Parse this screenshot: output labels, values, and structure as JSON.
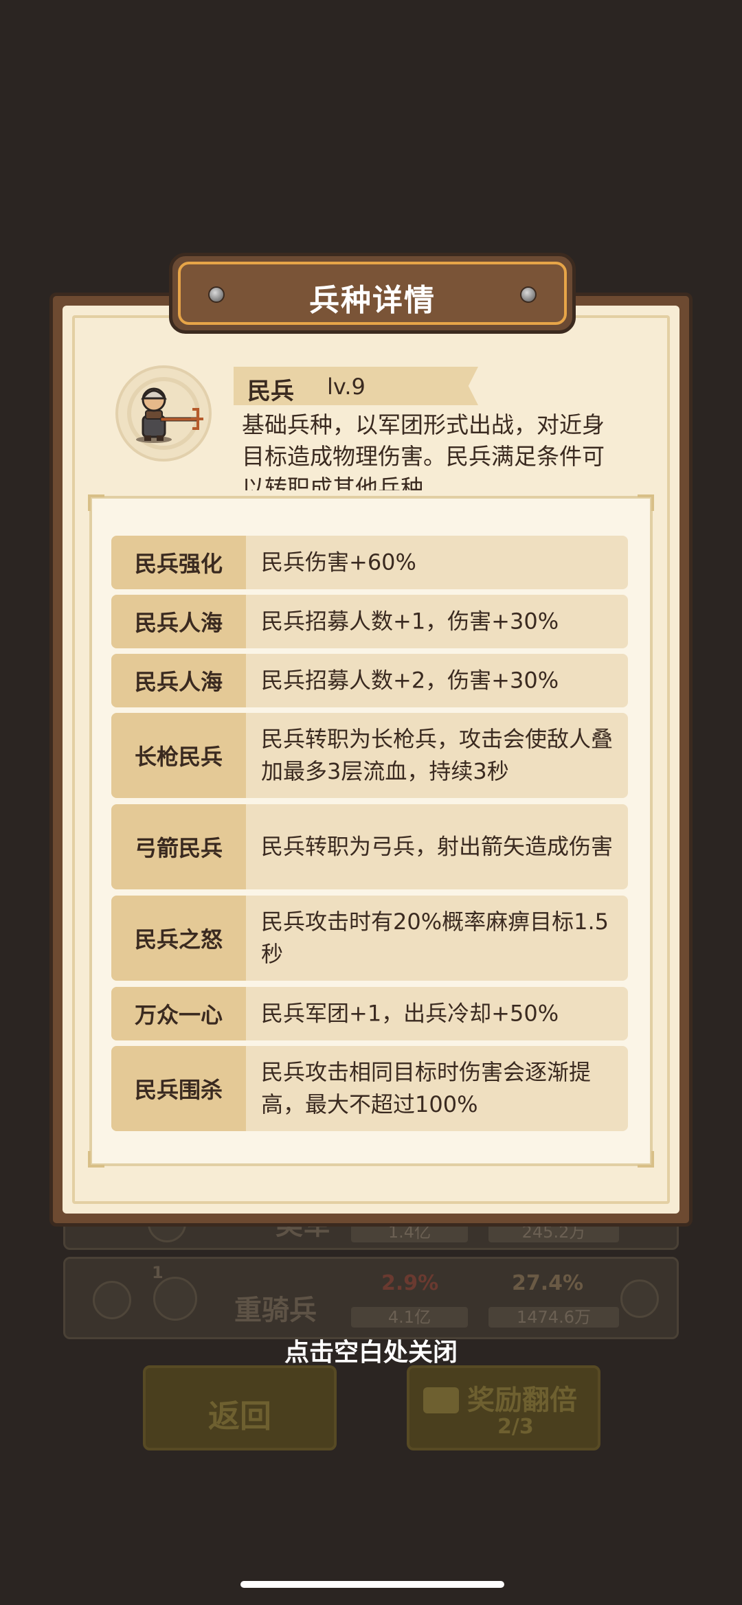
{
  "dialog": {
    "title": "兵种详情",
    "unit": {
      "name": "民兵",
      "level": "lv.9",
      "description": "基础兵种，以军团形式出战，对近身目标造成物理伤害。民兵满足条件可以转职成其他兵种。"
    },
    "upgrades": [
      {
        "name": "民兵强化",
        "effect": "民兵伤害+60%"
      },
      {
        "name": "民兵人海",
        "effect": "民兵招募人数+1，伤害+30%"
      },
      {
        "name": "民兵人海",
        "effect": "民兵招募人数+2，伤害+30%"
      },
      {
        "name": "长枪民兵",
        "effect": "民兵转职为长枪兵，攻击会使敌人叠加最多3层流血，持续3秒"
      },
      {
        "name": "弓箭民兵",
        "effect": "民兵转职为弓兵，射出箭矢造成伤害"
      },
      {
        "name": "民兵之怒",
        "effect": "民兵攻击时有20%概率麻痹目标1.5秒"
      },
      {
        "name": "万众一心",
        "effect": "民兵军团+1，出兵冷却+50%"
      },
      {
        "name": "民兵围杀",
        "effect": "民兵攻击相同目标时伤害会逐渐提高，最大不超过100%"
      }
    ]
  },
  "close_hint": "点击空白处关闭",
  "background": {
    "rows": [
      {
        "name": "美军",
        "stat_a": "1.4亿",
        "stat_b": "245.2万"
      },
      {
        "name": "重骑兵",
        "badge": "1",
        "pct_a": "2.9%",
        "pct_b": "27.4%",
        "stat_a": "4.1亿",
        "stat_b": "1474.6万"
      }
    ],
    "back_button": "返回",
    "double_reward_button": "奖励翻倍",
    "double_reward_count": "2/3"
  },
  "colors": {
    "backdrop": "#2b2522",
    "frame_brown": "#6d4a31",
    "parchment": "#f7ecd4",
    "row_bg": "#efdfc0",
    "label_bg": "#e4c996",
    "accent_orange": "#e7a548"
  }
}
